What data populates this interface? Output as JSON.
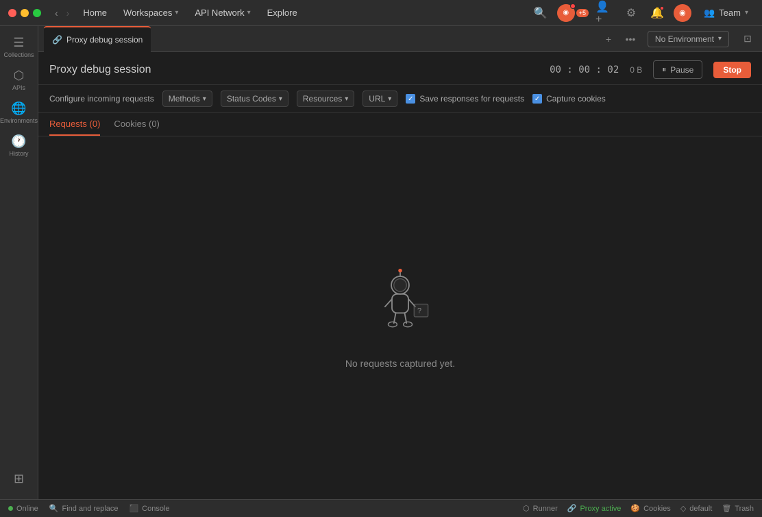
{
  "titlebar": {
    "nav_items": [
      "Home",
      "Workspaces",
      "API Network",
      "Explore"
    ],
    "team_label": "Team"
  },
  "tabs": {
    "active_tab": "Proxy debug session",
    "tab_icon": "🔗"
  },
  "env_selector": {
    "label": "No Environment"
  },
  "page": {
    "title": "Proxy debug session",
    "timer": {
      "hh": "00",
      "mm": "00",
      "ss": "02"
    },
    "size": "0 B",
    "pause_label": "Pause",
    "stop_label": "Stop"
  },
  "filters": {
    "configure_label": "Configure incoming requests",
    "methods_label": "Methods",
    "status_codes_label": "Status Codes",
    "resources_label": "Resources",
    "url_label": "URL",
    "save_responses_label": "Save responses for requests",
    "capture_cookies_label": "Capture cookies"
  },
  "content_tabs": [
    {
      "label": "Requests (0)",
      "active": true
    },
    {
      "label": "Cookies (0)",
      "active": false
    }
  ],
  "empty_state": {
    "text": "No requests captured yet."
  },
  "statusbar": {
    "online_label": "Online",
    "find_replace_label": "Find and replace",
    "console_label": "Console",
    "runner_label": "Runner",
    "proxy_active_label": "Proxy active",
    "cookies_label": "Cookies",
    "default_label": "default",
    "trash_label": "Trash"
  },
  "sidebar": {
    "items": [
      {
        "icon": "☰",
        "label": "Collections"
      },
      {
        "icon": "⬡",
        "label": "APIs"
      },
      {
        "icon": "🌐",
        "label": "Environments"
      },
      {
        "icon": "🕐",
        "label": "History"
      }
    ],
    "bottom_items": [
      {
        "icon": "⊞",
        "label": ""
      }
    ]
  }
}
